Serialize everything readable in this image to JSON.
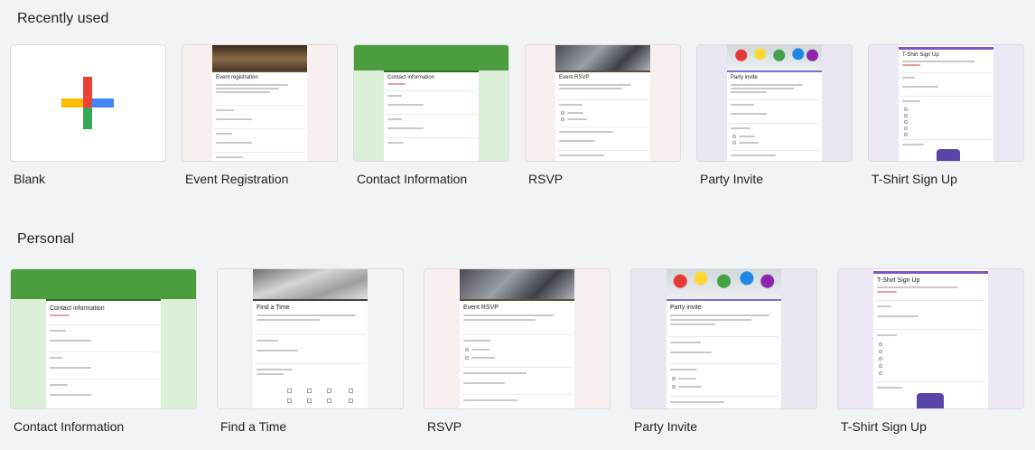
{
  "sections": {
    "recent": {
      "title": "Recently used",
      "items": [
        {
          "label": "Blank"
        },
        {
          "label": "Event Registration",
          "doc_title": "Event registration"
        },
        {
          "label": "Contact Information",
          "doc_title": "Contact information"
        },
        {
          "label": "RSVP",
          "doc_title": "Event RSVP"
        },
        {
          "label": "Party Invite",
          "doc_title": "Party invite"
        },
        {
          "label": "T-Shirt Sign Up",
          "doc_title": "T-Shirt Sign Up"
        }
      ]
    },
    "personal": {
      "title": "Personal",
      "items": [
        {
          "label": "Contact Information",
          "doc_title": "Contact information"
        },
        {
          "label": "Find a Time",
          "doc_title": "Find a Time"
        },
        {
          "label": "RSVP",
          "doc_title": "Event RSVP"
        },
        {
          "label": "Party Invite",
          "doc_title": "Party invite"
        },
        {
          "label": "T-Shirt Sign Up",
          "doc_title": "T-Shirt Sign Up"
        }
      ]
    }
  },
  "colors": {
    "contact": "#4a9c3c",
    "contact_bg": "#dcefd8",
    "event_bar": "#5f4b3a",
    "party_bar": "#7b6fd0",
    "tshirt_bar": "#7e57c2",
    "tshirt_bg": "#ede7f6"
  }
}
